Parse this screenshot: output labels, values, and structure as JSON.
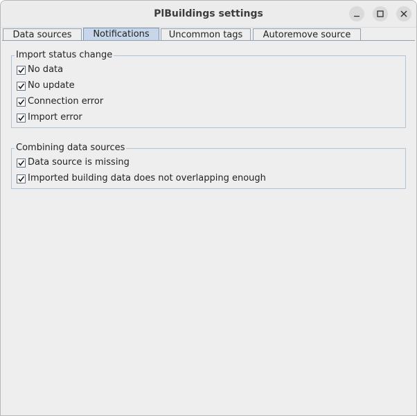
{
  "window": {
    "title": "PlBuildings settings",
    "minimize_icon": "minimize-icon",
    "maximize_icon": "maximize-icon",
    "close_icon": "close-icon"
  },
  "tabs": [
    {
      "label": "Data sources",
      "active": false
    },
    {
      "label": "Notifications",
      "active": true
    },
    {
      "label": "Uncommon tags",
      "active": false
    },
    {
      "label": "Autoremove source",
      "active": false
    }
  ],
  "groups": [
    {
      "title": "Import status change",
      "items": [
        {
          "label": "No data",
          "checked": true
        },
        {
          "label": "No update",
          "checked": true
        },
        {
          "label": "Connection error",
          "checked": true
        },
        {
          "label": "Import error",
          "checked": true
        }
      ]
    },
    {
      "title": "Combining data sources",
      "items": [
        {
          "label": "Data source is missing",
          "checked": true
        },
        {
          "label": "Imported building data does not overlapping enough",
          "checked": true
        }
      ]
    }
  ],
  "colors": {
    "window_bg": "#eeeeee",
    "active_tab": "#c7d6e8",
    "group_border": "#b3c3d6"
  }
}
